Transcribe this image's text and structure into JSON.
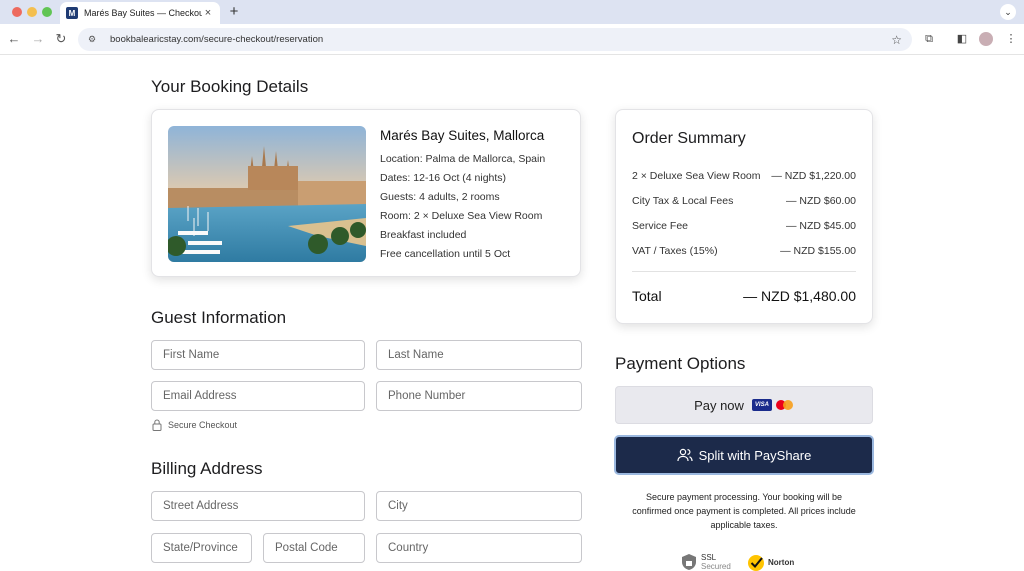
{
  "browser": {
    "tab_title": "Marés Bay Suites — Checkout",
    "favicon_letter": "M",
    "url": "bookbalearicstay.com/secure-checkout/reservation",
    "traffic_colors": [
      "#ed6a5e",
      "#f4bf4f",
      "#61c554"
    ]
  },
  "booking": {
    "heading": "Your Booking Details",
    "hotel_name": "Marés Bay Suites, Mallorca",
    "lines": [
      "Location: Palma de Mallorca, Spain",
      "Dates: 12-16 Oct (4 nights)",
      "Guests: 4 adults, 2 rooms",
      "Room: 2 × Deluxe Sea View Room",
      "Breakfast included",
      "Free cancellation until 5 Oct"
    ]
  },
  "order_summary": {
    "title": "Order Summary",
    "rows": [
      {
        "label": "2 × Deluxe Sea View Room",
        "amount": "— NZD $1,220.00"
      },
      {
        "label": "City Tax & Local Fees",
        "amount": "— NZD $60.00"
      },
      {
        "label": "Service Fee",
        "amount": "— NZD $45.00"
      },
      {
        "label": "VAT / Taxes (15%)",
        "amount": "— NZD $155.00"
      }
    ],
    "total_label": "Total",
    "total_amount": "— NZD $1,480.00"
  },
  "guest": {
    "heading": "Guest Information",
    "first_name": "First Name",
    "last_name": "Last Name",
    "email": "Email Address",
    "phone": "Phone Number",
    "secure_note": "Secure Checkout"
  },
  "billing": {
    "heading": "Billing Address",
    "street": "Street Address",
    "city": "City",
    "state": "State/Province",
    "postal": "Postal Code",
    "country": "Country"
  },
  "payment": {
    "heading": "Payment Options",
    "pay_now": "Pay now",
    "visa": "VISA",
    "split": "Split with PayShare",
    "note": "Secure payment processing. Your booking will be confirmed once payment is completed. All prices include applicable taxes.",
    "ssl_label": "SSL",
    "ssl_sub": "Secured",
    "norton_label": "Norton",
    "accent": "#1c2a4a"
  }
}
